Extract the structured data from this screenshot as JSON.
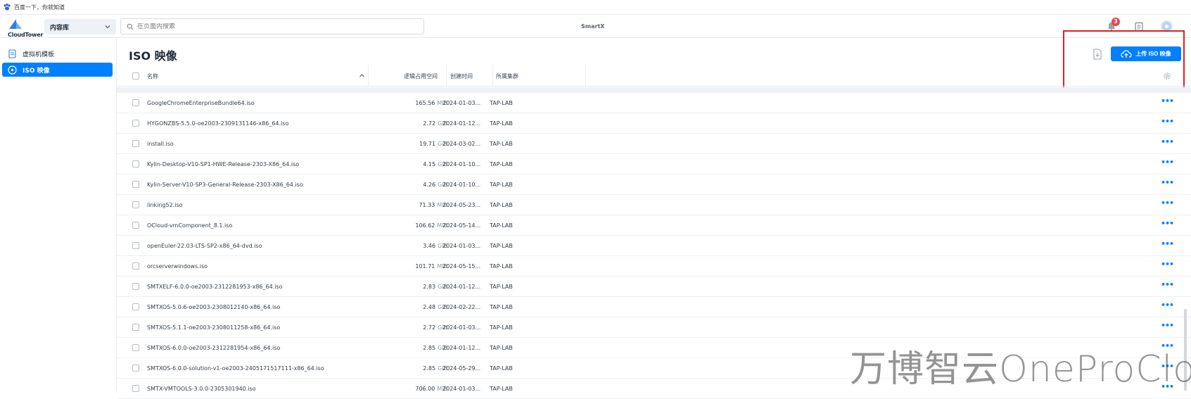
{
  "browser": {
    "tab_title": "百度一下，你就知道"
  },
  "topbar": {
    "logo_text": "CloudTower",
    "library_select": "内容库",
    "search_placeholder": "在页面内搜索",
    "brand": "SmartX",
    "notification_count": "3"
  },
  "sidebar": {
    "items": [
      {
        "label": "虚拟机模板",
        "active": false
      },
      {
        "label": "ISO 映像",
        "active": true
      }
    ]
  },
  "page": {
    "title": "ISO 映像",
    "upload_button": "上传 ISO 映像"
  },
  "table": {
    "columns": [
      "名称",
      "逻辑占用空间",
      "创建时间",
      "所属集群"
    ],
    "rows": [
      {
        "name": "GoogleChromeEnterpriseBundle64.iso",
        "size": "165.56",
        "unit": "MiB",
        "date": "2024-01-03...",
        "cluster": "TAP-LAB"
      },
      {
        "name": "HYGONZBS-5.5.0-oe2003-2309131146-x86_64.iso",
        "size": "2.72",
        "unit": "GiB",
        "date": "2024-01-12...",
        "cluster": "TAP-LAB"
      },
      {
        "name": "install.iso",
        "size": "19.71",
        "unit": "GiB",
        "date": "2024-03-02...",
        "cluster": "TAP-LAB"
      },
      {
        "name": "Kylin-Desktop-V10-SP1-HWE-Release-2303-X86_64.iso",
        "size": "4.15",
        "unit": "GiB",
        "date": "2024-01-10...",
        "cluster": "TAP-LAB"
      },
      {
        "name": "Kylin-Server-V10-SP3-General-Release-2303-X86_64.iso",
        "size": "4.26",
        "unit": "GiB",
        "date": "2024-01-10...",
        "cluster": "TAP-LAB"
      },
      {
        "name": "linking52.iso",
        "size": "71.33",
        "unit": "MiB",
        "date": "2024-05-23...",
        "cluster": "TAP-LAB"
      },
      {
        "name": "OCloud-vmComponent_8.1.iso",
        "size": "106.62",
        "unit": "MiB",
        "date": "2024-05-14...",
        "cluster": "TAP-LAB"
      },
      {
        "name": "openEuler-22.03-LTS-SP2-x86_64-dvd.iso",
        "size": "3.46",
        "unit": "GiB",
        "date": "2024-01-03...",
        "cluster": "TAP-LAB"
      },
      {
        "name": "orcserverwindows.iso",
        "size": "101.71",
        "unit": "MiB",
        "date": "2024-05-15...",
        "cluster": "TAP-LAB"
      },
      {
        "name": "SMTXELF-6.0.0-oe2003-2312281953-x86_64.iso",
        "size": "2.83",
        "unit": "GiB",
        "date": "2024-01-12...",
        "cluster": "TAP-LAB"
      },
      {
        "name": "SMTXOS-5.0.6-oe2003-2308012140-x86_64.iso",
        "size": "2.48",
        "unit": "GiB",
        "date": "2024-02-22...",
        "cluster": "TAP-LAB"
      },
      {
        "name": "SMTXOS-5.1.1-oe2003-2308011258-x86_64.iso",
        "size": "2.72",
        "unit": "GiB",
        "date": "2024-01-03...",
        "cluster": "TAP-LAB"
      },
      {
        "name": "SMTXOS-6.0.0-oe2003-2312281954-x86_64.iso",
        "size": "2.85",
        "unit": "GiB",
        "date": "2024-01-12...",
        "cluster": "TAP-LAB"
      },
      {
        "name": "SMTXOS-6.0.0-solution-v1-oe2003-2405171517111-x86_64.iso",
        "size": "2.85",
        "unit": "GiB",
        "date": "2024-05-29...",
        "cluster": "TAP-LAB"
      },
      {
        "name": "SMTX-VMTOOLS-3.0.0-2305301940.iso",
        "size": "706.00",
        "unit": "MiB",
        "date": "2024-01-03...",
        "cluster": "TAP-LAB"
      }
    ]
  },
  "watermark": "万博智云OneProCloud",
  "colors": {
    "accent": "#0080ff",
    "highlight": "#e02020",
    "badge": "#e5484d"
  }
}
